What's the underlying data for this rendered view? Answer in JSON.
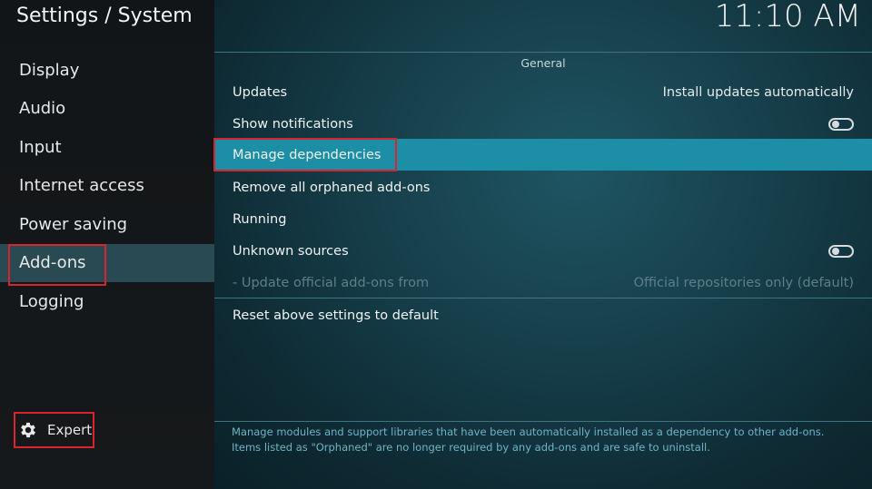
{
  "header": {
    "title": "Settings / System",
    "clock": "11:10 AM"
  },
  "sidebar": {
    "items": [
      {
        "label": "Display"
      },
      {
        "label": "Audio"
      },
      {
        "label": "Input"
      },
      {
        "label": "Internet access"
      },
      {
        "label": "Power saving"
      },
      {
        "label": "Add-ons",
        "active": true
      },
      {
        "label": "Logging"
      }
    ],
    "expert_label": "Expert"
  },
  "main": {
    "section": "General",
    "rows": [
      {
        "label": "Updates",
        "value": "Install updates automatically"
      },
      {
        "label": "Show notifications",
        "toggle": "off"
      },
      {
        "label": "Manage dependencies",
        "focused": true
      },
      {
        "label": "Remove all orphaned add-ons"
      },
      {
        "label": "Running"
      },
      {
        "label": "Unknown sources",
        "toggle": "off"
      },
      {
        "label": "- Update official add-ons from",
        "value": "Official repositories only (default)",
        "disabled": true
      },
      {
        "label": "Reset above settings to default"
      }
    ],
    "description_line1": "Manage modules and support libraries that have been automatically installed as a dependency to other add-ons.",
    "description_line2": "Items listed as \"Orphaned\" are no longer required by any add-ons and are safe to uninstall."
  },
  "colors": {
    "focus": "#1c8ea6",
    "highlight_border": "#d8242f",
    "sidebar_active": "#2a4a53"
  }
}
